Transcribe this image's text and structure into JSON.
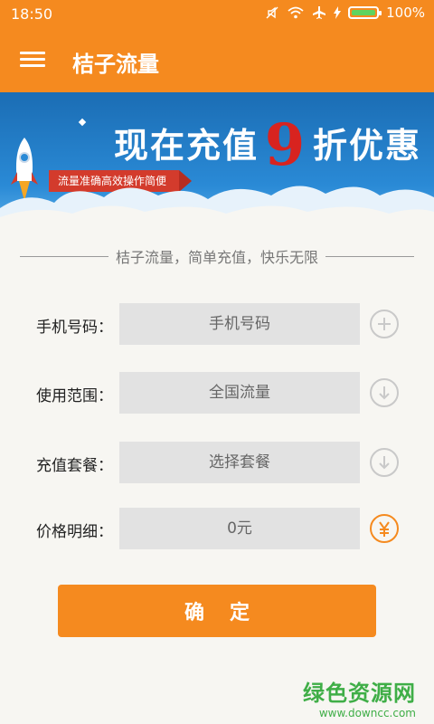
{
  "status_bar": {
    "time": "18:50",
    "battery_percent": "100%",
    "battery_level": 1.0,
    "icons": [
      "mute-icon",
      "wifi-icon",
      "airplane-icon",
      "charging-icon",
      "battery-icon"
    ]
  },
  "app_bar": {
    "title": "桔子流量",
    "menu_icon": "menu-icon"
  },
  "banner": {
    "headline_left": "现在充值",
    "headline_number": "9",
    "headline_right": "折优惠",
    "ribbon_text": "流量准确高效操作简便"
  },
  "tagline": "桔子流量，简单充值，快乐无限",
  "form": {
    "phone": {
      "label": "手机号码：",
      "placeholder": "手机号码",
      "icon": "add-contact-icon"
    },
    "scope": {
      "label": "使用范围：",
      "value": "全国流量",
      "icon": "dropdown-icon"
    },
    "package": {
      "label": "充值套餐：",
      "value": "选择套餐",
      "icon": "dropdown-icon"
    },
    "price": {
      "label": "价格明细：",
      "value": "0元",
      "icon": "yen-icon"
    }
  },
  "confirm_label": "确定",
  "watermark": {
    "title": "绿色资源网",
    "url": "www.downcc.com"
  },
  "colors": {
    "accent": "#f58a1f",
    "banner_blue": "#1b6db4",
    "highlight_red": "#d8231f",
    "field_bg": "#e2e2e2",
    "watermark_green": "#3fae47"
  }
}
